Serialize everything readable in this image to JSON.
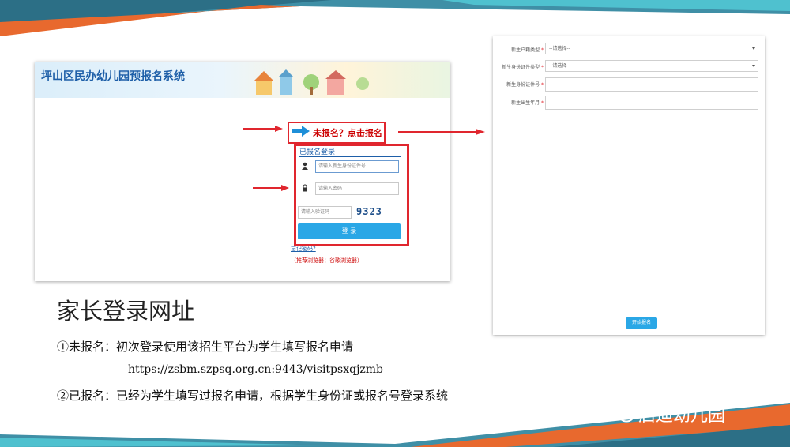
{
  "left_screenshot": {
    "title": "坪山区民办幼儿园预报名系统",
    "not_registered_link": "未报名？点击报名",
    "login_heading": "已报名登录",
    "id_placeholder": "请输入新生身份证件号",
    "password_placeholder": "请输入密码",
    "captcha_placeholder": "请输入验证码",
    "captcha_code": "9323",
    "login_button": "登 录",
    "forgot_password": "忘记密码?",
    "browser_note": "（推荐浏览器：谷歌浏览器）"
  },
  "right_screenshot": {
    "fields": [
      {
        "label": "新生户籍类型",
        "value": "--请选择--",
        "type": "select"
      },
      {
        "label": "新生身份证件类型",
        "value": "--请选择--",
        "type": "select"
      },
      {
        "label": "新生身份证件号",
        "value": "",
        "type": "input"
      },
      {
        "label": "新生出生年月",
        "value": "",
        "type": "input"
      }
    ],
    "required_mark": "*",
    "start_button": "开始报名"
  },
  "slide": {
    "heading": "家长登录网址",
    "line1": "①未报名：初次登录使用该招生平台为学生填写报名申请",
    "url": "https://zsbm.szpsq.org.cn:9443/visitpsxqjzmb",
    "line2": "②已报名：已经为学生填写过报名申请，根据学生身份证或报名号登录系统",
    "watermark": "启迪幼儿园"
  },
  "colors": {
    "band_blue": "#3f8fa6",
    "band_orange": "#e8692e",
    "band_cyan": "#4fc1cf",
    "highlight_red": "#e0262e",
    "button_blue": "#2aa7e6"
  }
}
